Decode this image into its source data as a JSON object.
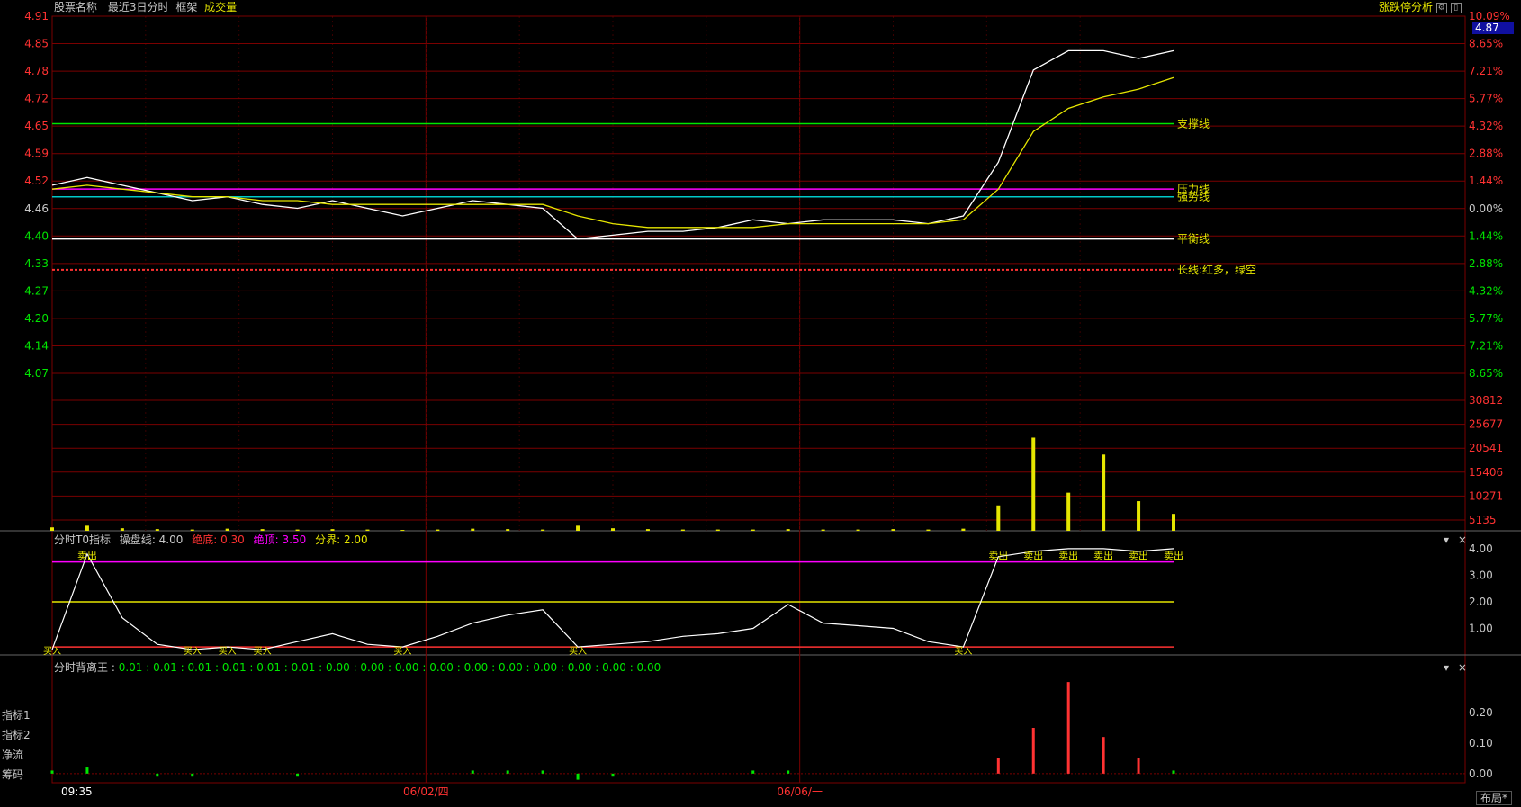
{
  "header": {
    "stock_name": "股票名称",
    "period": "最近3日分时",
    "frame": "框架",
    "volume_label": "成交量",
    "right_tool": "涨跌停分析"
  },
  "colors": {
    "background": "#000000",
    "grid": "#7a0000",
    "price_line": "#ffffff",
    "avg_line": "#e6e600",
    "up": "#ff3232",
    "down": "#00e600",
    "magenta": "#ff00ff"
  },
  "chart_data": [
    {
      "type": "line",
      "panel": "price",
      "ylim": [
        4.0,
        5.0
      ],
      "y_ticks_left": [
        "4.91",
        "4.85",
        "4.78",
        "4.72",
        "4.65",
        "4.59",
        "4.52",
        "4.46",
        "4.40",
        "4.33",
        "4.27",
        "4.20",
        "4.14",
        "4.07"
      ],
      "y_ticks_right": [
        "10.09%",
        "8.65%",
        "7.21%",
        "5.77%",
        "4.32%",
        "2.88%",
        "1.44%",
        "0.00%",
        "1.44%",
        "2.88%",
        "4.32%",
        "5.77%",
        "7.21%",
        "8.65%"
      ],
      "current_price": "4.87",
      "base_price": 4.46,
      "x_labels": [
        "09:35",
        "06/02/四",
        "06/06/一"
      ],
      "series": [
        {
          "name": "价格",
          "values": [
            4.56,
            4.58,
            4.56,
            4.54,
            4.52,
            4.53,
            4.51,
            4.5,
            4.52,
            4.5,
            4.48,
            4.5,
            4.52,
            4.51,
            4.5,
            4.42,
            4.43,
            4.44,
            4.44,
            4.45,
            4.47,
            4.46,
            4.47,
            4.47,
            4.47,
            4.46,
            4.48,
            4.62,
            4.86,
            4.91,
            4.91,
            4.89,
            4.91
          ]
        },
        {
          "name": "均价",
          "values": [
            4.55,
            4.56,
            4.55,
            4.54,
            4.53,
            4.53,
            4.52,
            4.52,
            4.51,
            4.51,
            4.51,
            4.51,
            4.51,
            4.51,
            4.51,
            4.48,
            4.46,
            4.45,
            4.45,
            4.45,
            4.45,
            4.46,
            4.46,
            4.46,
            4.46,
            4.46,
            4.47,
            4.55,
            4.7,
            4.76,
            4.79,
            4.81,
            4.84
          ]
        }
      ],
      "lines": [
        {
          "name": "支撑线",
          "value": 4.72
        },
        {
          "name": "压力线",
          "value": 4.55
        },
        {
          "name": "强势线",
          "value": 4.53
        },
        {
          "name": "平衡线",
          "value": 4.42
        },
        {
          "name": "长线:红多，绿空",
          "value": 4.34
        }
      ]
    },
    {
      "type": "bar",
      "panel": "volume",
      "ylim": [
        0,
        30812
      ],
      "y_ticks": [
        "30812",
        "25677",
        "20541",
        "15406",
        "10271",
        "5135"
      ],
      "values": [
        800,
        1200,
        600,
        400,
        300,
        500,
        400,
        300,
        400,
        300,
        200,
        300,
        500,
        400,
        300,
        1200,
        600,
        400,
        300,
        300,
        300,
        400,
        300,
        300,
        400,
        300,
        500,
        6000,
        22000,
        9000,
        18000,
        7000,
        4000
      ]
    },
    {
      "type": "line",
      "panel": "indicator",
      "title": "分时T0指标",
      "params": [
        {
          "name": "操盘线",
          "value": "4.00"
        },
        {
          "name": "绝底",
          "value": "0.30"
        },
        {
          "name": "绝顶",
          "value": "3.50"
        },
        {
          "name": "分界",
          "value": "2.00"
        }
      ],
      "ylim": [
        0,
        4.2
      ],
      "y_ticks": [
        "4.00",
        "3.00",
        "2.00",
        "1.00"
      ],
      "values": [
        0.2,
        3.8,
        1.4,
        0.4,
        0.2,
        0.3,
        0.2,
        0.5,
        0.8,
        0.4,
        0.3,
        0.7,
        1.2,
        1.5,
        1.7,
        0.3,
        0.4,
        0.5,
        0.7,
        0.8,
        1.0,
        1.9,
        1.2,
        1.1,
        1.0,
        0.5,
        0.3,
        3.7,
        3.9,
        4.0,
        4.0,
        3.9,
        4.0
      ],
      "signals": [
        "卖出",
        "买入"
      ]
    },
    {
      "type": "bar",
      "panel": "secondary",
      "title": "分时背离王",
      "header_values": "0.01 : 0.01 : 0.01 : 0.01 : 0.01 : 0.01 : 0.00 : 0.00 : 0.00 : 0.00 : 0.00 : 0.00 : 0.00 : 0.00 : 0.00 : 0.00",
      "ylim": [
        -0.03,
        0.33
      ],
      "y_ticks": [
        "0.20",
        "0.10",
        "0.00"
      ],
      "values": [
        0.01,
        0.02,
        0.0,
        -0.01,
        -0.01,
        0.0,
        0.0,
        -0.01,
        0.0,
        0.0,
        0.0,
        0.0,
        0.01,
        0.01,
        0.01,
        -0.02,
        -0.01,
        0.0,
        0.0,
        0.0,
        0.01,
        0.01,
        0.0,
        0.0,
        0.0,
        0.0,
        0.0,
        0.05,
        0.15,
        0.3,
        0.12,
        0.05,
        0.01
      ]
    }
  ],
  "side_labels": [
    "指标1",
    "指标2",
    "净流",
    "筹码"
  ],
  "footer": {
    "layout_label": "布局*"
  }
}
